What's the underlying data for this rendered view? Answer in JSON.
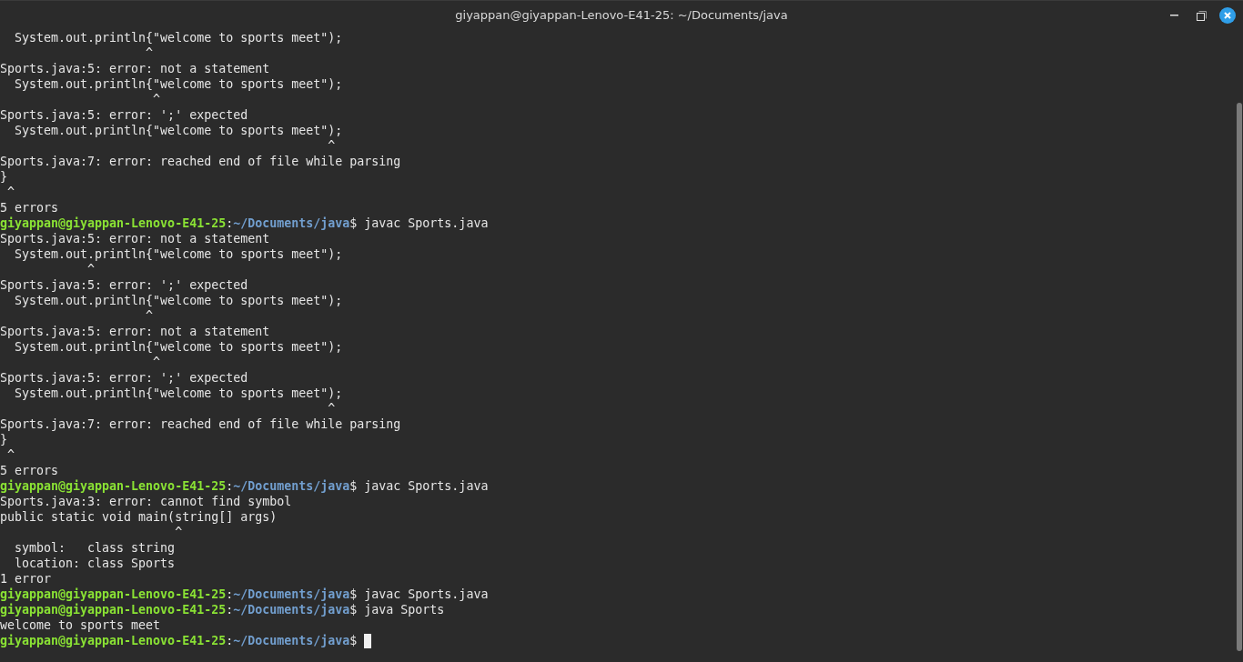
{
  "window": {
    "title": "giyappan@giyappan-Lenovo-E41-25: ~/Documents/java"
  },
  "terminal": {
    "lines": [
      {
        "kind": "output",
        "text": "  System.out.println{\"welcome to sports meet\");"
      },
      {
        "kind": "output",
        "text": "                    ^"
      },
      {
        "kind": "output",
        "text": "Sports.java:5: error: not a statement"
      },
      {
        "kind": "output",
        "text": "  System.out.println{\"welcome to sports meet\");"
      },
      {
        "kind": "output",
        "text": "                     ^"
      },
      {
        "kind": "output",
        "text": "Sports.java:5: error: ';' expected"
      },
      {
        "kind": "output",
        "text": "  System.out.println{\"welcome to sports meet\");"
      },
      {
        "kind": "output",
        "text": "                                             ^"
      },
      {
        "kind": "output",
        "text": "Sports.java:7: error: reached end of file while parsing"
      },
      {
        "kind": "output",
        "text": "}"
      },
      {
        "kind": "output",
        "text": " ^"
      },
      {
        "kind": "output",
        "text": "5 errors"
      },
      {
        "kind": "prompt",
        "user": "giyappan@giyappan-Lenovo-E41-25",
        "sep": ":",
        "path": "~/Documents/java",
        "symbol": "$",
        "command": " javac Sports.java",
        "cursor": false
      },
      {
        "kind": "output",
        "text": "Sports.java:5: error: not a statement"
      },
      {
        "kind": "output",
        "text": "  System.out.println{\"welcome to sports meet\");"
      },
      {
        "kind": "output",
        "text": "            ^"
      },
      {
        "kind": "output",
        "text": "Sports.java:5: error: ';' expected"
      },
      {
        "kind": "output",
        "text": "  System.out.println{\"welcome to sports meet\");"
      },
      {
        "kind": "output",
        "text": "                    ^"
      },
      {
        "kind": "output",
        "text": "Sports.java:5: error: not a statement"
      },
      {
        "kind": "output",
        "text": "  System.out.println{\"welcome to sports meet\");"
      },
      {
        "kind": "output",
        "text": "                     ^"
      },
      {
        "kind": "output",
        "text": "Sports.java:5: error: ';' expected"
      },
      {
        "kind": "output",
        "text": "  System.out.println{\"welcome to sports meet\");"
      },
      {
        "kind": "output",
        "text": "                                             ^"
      },
      {
        "kind": "output",
        "text": "Sports.java:7: error: reached end of file while parsing"
      },
      {
        "kind": "output",
        "text": "}"
      },
      {
        "kind": "output",
        "text": " ^"
      },
      {
        "kind": "output",
        "text": "5 errors"
      },
      {
        "kind": "prompt",
        "user": "giyappan@giyappan-Lenovo-E41-25",
        "sep": ":",
        "path": "~/Documents/java",
        "symbol": "$",
        "command": " javac Sports.java",
        "cursor": false
      },
      {
        "kind": "output",
        "text": "Sports.java:3: error: cannot find symbol"
      },
      {
        "kind": "output",
        "text": "public static void main(string[] args)"
      },
      {
        "kind": "output",
        "text": "                        ^"
      },
      {
        "kind": "output",
        "text": "  symbol:   class string"
      },
      {
        "kind": "output",
        "text": "  location: class Sports"
      },
      {
        "kind": "output",
        "text": "1 error"
      },
      {
        "kind": "prompt",
        "user": "giyappan@giyappan-Lenovo-E41-25",
        "sep": ":",
        "path": "~/Documents/java",
        "symbol": "$",
        "command": " javac Sports.java",
        "cursor": false
      },
      {
        "kind": "prompt",
        "user": "giyappan@giyappan-Lenovo-E41-25",
        "sep": ":",
        "path": "~/Documents/java",
        "symbol": "$",
        "command": " java Sports",
        "cursor": false
      },
      {
        "kind": "output",
        "text": "welcome to sports meet"
      },
      {
        "kind": "prompt",
        "user": "giyappan@giyappan-Lenovo-E41-25",
        "sep": ":",
        "path": "~/Documents/java",
        "symbol": "$",
        "cursor": true
      }
    ]
  }
}
